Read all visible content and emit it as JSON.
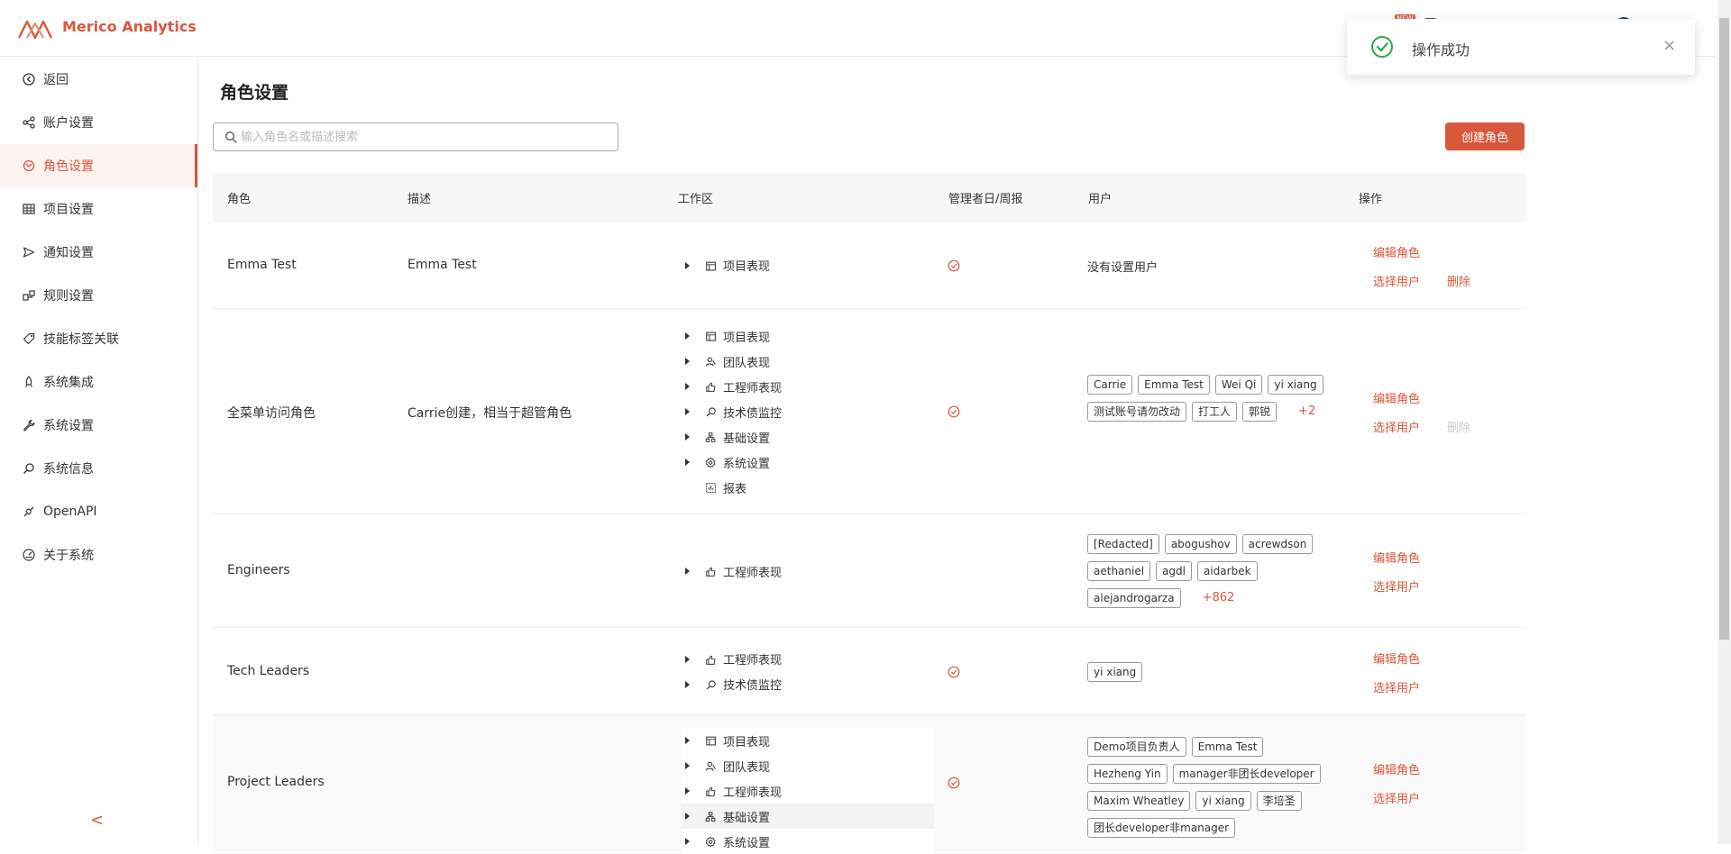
{
  "app": {
    "name": "Merico Analytics"
  },
  "header": {
    "badge": "NEW"
  },
  "toast": {
    "message": "操作成功",
    "icon": "check-circle-icon",
    "close": "×"
  },
  "sidebar": {
    "items": [
      {
        "label": "返回",
        "icon": "back-icon"
      },
      {
        "label": "账户设置",
        "icon": "account-icon"
      },
      {
        "label": "角色设置",
        "icon": "role-icon",
        "active": true
      },
      {
        "label": "项目设置",
        "icon": "table-icon"
      },
      {
        "label": "通知设置",
        "icon": "send-icon"
      },
      {
        "label": "规则设置",
        "icon": "rules-icon"
      },
      {
        "label": "技能标签关联",
        "icon": "tag-icon"
      },
      {
        "label": "系统集成",
        "icon": "rocket-icon"
      },
      {
        "label": "系统设置",
        "icon": "wrench-icon"
      },
      {
        "label": "系统信息",
        "icon": "search-icon"
      },
      {
        "label": "OpenAPI",
        "icon": "api-icon"
      },
      {
        "label": "关于系统",
        "icon": "gauge-icon"
      }
    ],
    "collapse": "<"
  },
  "main": {
    "title": "角色设置",
    "search_placeholder": "输入角色名或描述搜索",
    "create_button": "创建角色"
  },
  "table": {
    "headers": {
      "role": "角色",
      "desc": "描述",
      "workspace": "工作区",
      "report": "管理者日/周报",
      "users": "用户",
      "ops": "操作"
    },
    "ops_labels": {
      "edit": "编辑角色",
      "select_users": "选择用户",
      "delete": "删除"
    },
    "rows": [
      {
        "name": "Emma Test",
        "desc": "Emma Test",
        "workspaces": [
          {
            "label": "项目表现",
            "icon": "board-icon",
            "expandable": true
          }
        ],
        "report": true,
        "no_users": "没有设置用户",
        "users": [],
        "more": "",
        "delete": "enabled"
      },
      {
        "name": "全菜单访问角色",
        "desc": "Carrie创建，相当于超管角色",
        "workspaces": [
          {
            "label": "项目表现",
            "icon": "board-icon",
            "expandable": true
          },
          {
            "label": "团队表现",
            "icon": "team-icon",
            "expandable": true
          },
          {
            "label": "工程师表现",
            "icon": "thumb-icon",
            "expandable": true
          },
          {
            "label": "技术债监控",
            "icon": "monitor-icon",
            "expandable": true
          },
          {
            "label": "基础设置",
            "icon": "org-icon",
            "expandable": true
          },
          {
            "label": "系统设置",
            "icon": "gear-icon",
            "expandable": true
          },
          {
            "label": "报表",
            "icon": "report-icon",
            "expandable": false
          }
        ],
        "report": true,
        "no_users": "",
        "users": [
          "Carrie",
          "Emma Test",
          "Wei Qi",
          "yi xiang",
          "测试账号请勿改动",
          "打工人",
          "郭锐"
        ],
        "more": "+2",
        "delete": "disabled"
      },
      {
        "name": "Engineers",
        "desc": "",
        "workspaces": [
          {
            "label": "工程师表现",
            "icon": "thumb-icon",
            "expandable": true
          }
        ],
        "report": false,
        "no_users": "",
        "users": [
          "[Redacted]",
          "abogushov",
          "acrewdson",
          "aethaniel",
          "agdl",
          "aidarbek",
          "alejandrogarza"
        ],
        "more": "+862",
        "delete": "none"
      },
      {
        "name": "Tech Leaders",
        "desc": "",
        "workspaces": [
          {
            "label": "工程师表现",
            "icon": "thumb-icon",
            "expandable": true
          },
          {
            "label": "技术债监控",
            "icon": "monitor-icon",
            "expandable": true
          }
        ],
        "report": true,
        "no_users": "",
        "users": [
          "yi xiang"
        ],
        "more": "",
        "delete": "none"
      },
      {
        "name": "Project Leaders",
        "desc": "",
        "workspaces": [
          {
            "label": "项目表现",
            "icon": "board-icon",
            "expandable": true
          },
          {
            "label": "团队表现",
            "icon": "team-icon",
            "expandable": true
          },
          {
            "label": "工程师表现",
            "icon": "thumb-icon",
            "expandable": true
          },
          {
            "label": "基础设置",
            "icon": "org-icon",
            "expandable": true,
            "highlight": true
          },
          {
            "label": "系统设置",
            "icon": "gear-icon",
            "expandable": true
          }
        ],
        "report": true,
        "no_users": "",
        "users": [
          "Demo项目负责人",
          "Emma Test",
          "Hezheng Yin",
          "manager非团长developer",
          "Maxim Wheatley",
          "yi xiang",
          "李培圣",
          "团长developer非manager"
        ],
        "more": "",
        "delete": "none"
      }
    ]
  },
  "colors": {
    "accent": "#d9573a",
    "success": "#2ba84a"
  }
}
